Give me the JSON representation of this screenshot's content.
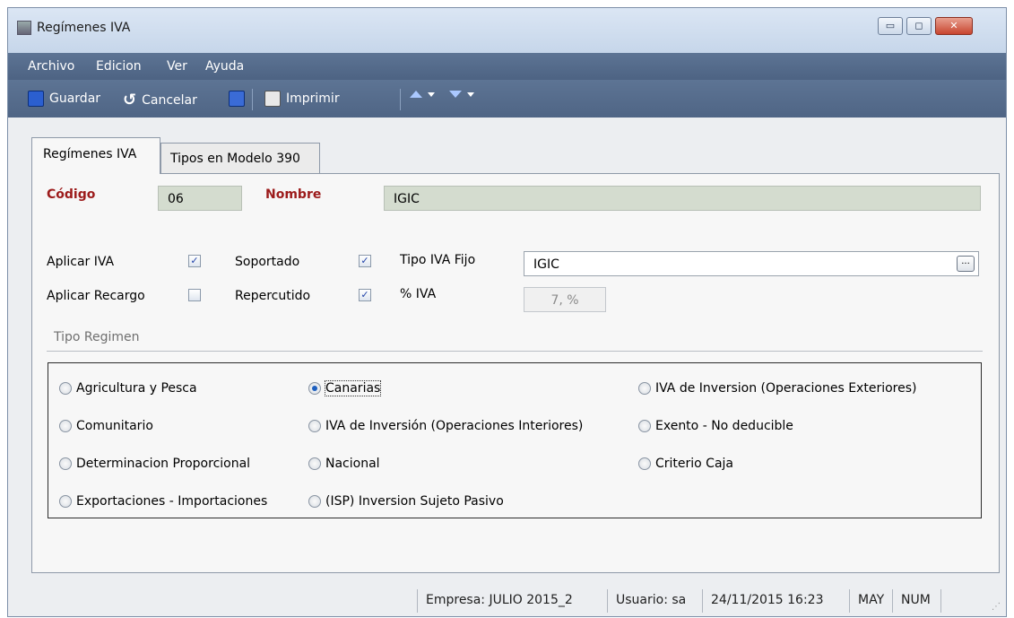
{
  "window": {
    "title": "Regímenes IVA",
    "controls": {
      "minimize": "▭",
      "maximize": "◻",
      "close": "✕"
    }
  },
  "menu": {
    "items": [
      "Archivo",
      "Edicion",
      "Ver",
      "Ayuda"
    ],
    "mnemonics": [
      "A",
      "E",
      "V",
      "y"
    ]
  },
  "toolbar": {
    "save_label": "Guardar",
    "cancel_label": "Cancelar",
    "print_label": "Imprimir",
    "icons": [
      "save-icon",
      "undo-icon",
      "save-as-icon",
      "print-icon",
      "arrow-up-icon",
      "arrow-down-icon"
    ]
  },
  "tabs": [
    "Regímenes IVA",
    "Tipos en Modelo 390"
  ],
  "form": {
    "codigo_label": "Código",
    "codigo_value": "06",
    "nombre_label": "Nombre",
    "nombre_value": "IGIC",
    "aplicar_iva_label": "Aplicar IVA",
    "aplicar_recargo_label": "Aplicar Recargo",
    "soportado_label": "Soportado",
    "repercutido_label": "Repercutido",
    "tipo_iva_fijo_label": "Tipo IVA Fijo",
    "tipo_iva_fijo_value": "IGIC",
    "browse_label": "...",
    "pct_iva_label": "% IVA",
    "pct_iva_value": "7,   %",
    "checks": {
      "aplicar_iva": true,
      "aplicar_recargo": false,
      "soportado": true,
      "repercutido": true
    }
  },
  "tipo_regimen": {
    "label": "Tipo Regimen",
    "options": [
      "Agricultura y Pesca",
      "Canarias",
      "IVA de Inversion (Operaciones Exteriores)",
      "Comunitario",
      "IVA de Inversión (Operaciones Interiores)",
      "Exento - No deducible",
      "Determinacion Proporcional",
      "Nacional",
      "Criterio Caja",
      "Exportaciones - Importaciones",
      "(ISP) Inversion Sujeto Pasivo"
    ],
    "selected": "Canarias"
  },
  "status": {
    "empresa": "Empresa: JULIO 2015_2",
    "usuario": "Usuario: sa",
    "datetime": "24/11/2015 16:23",
    "caps": "MAY",
    "num": "NUM"
  }
}
